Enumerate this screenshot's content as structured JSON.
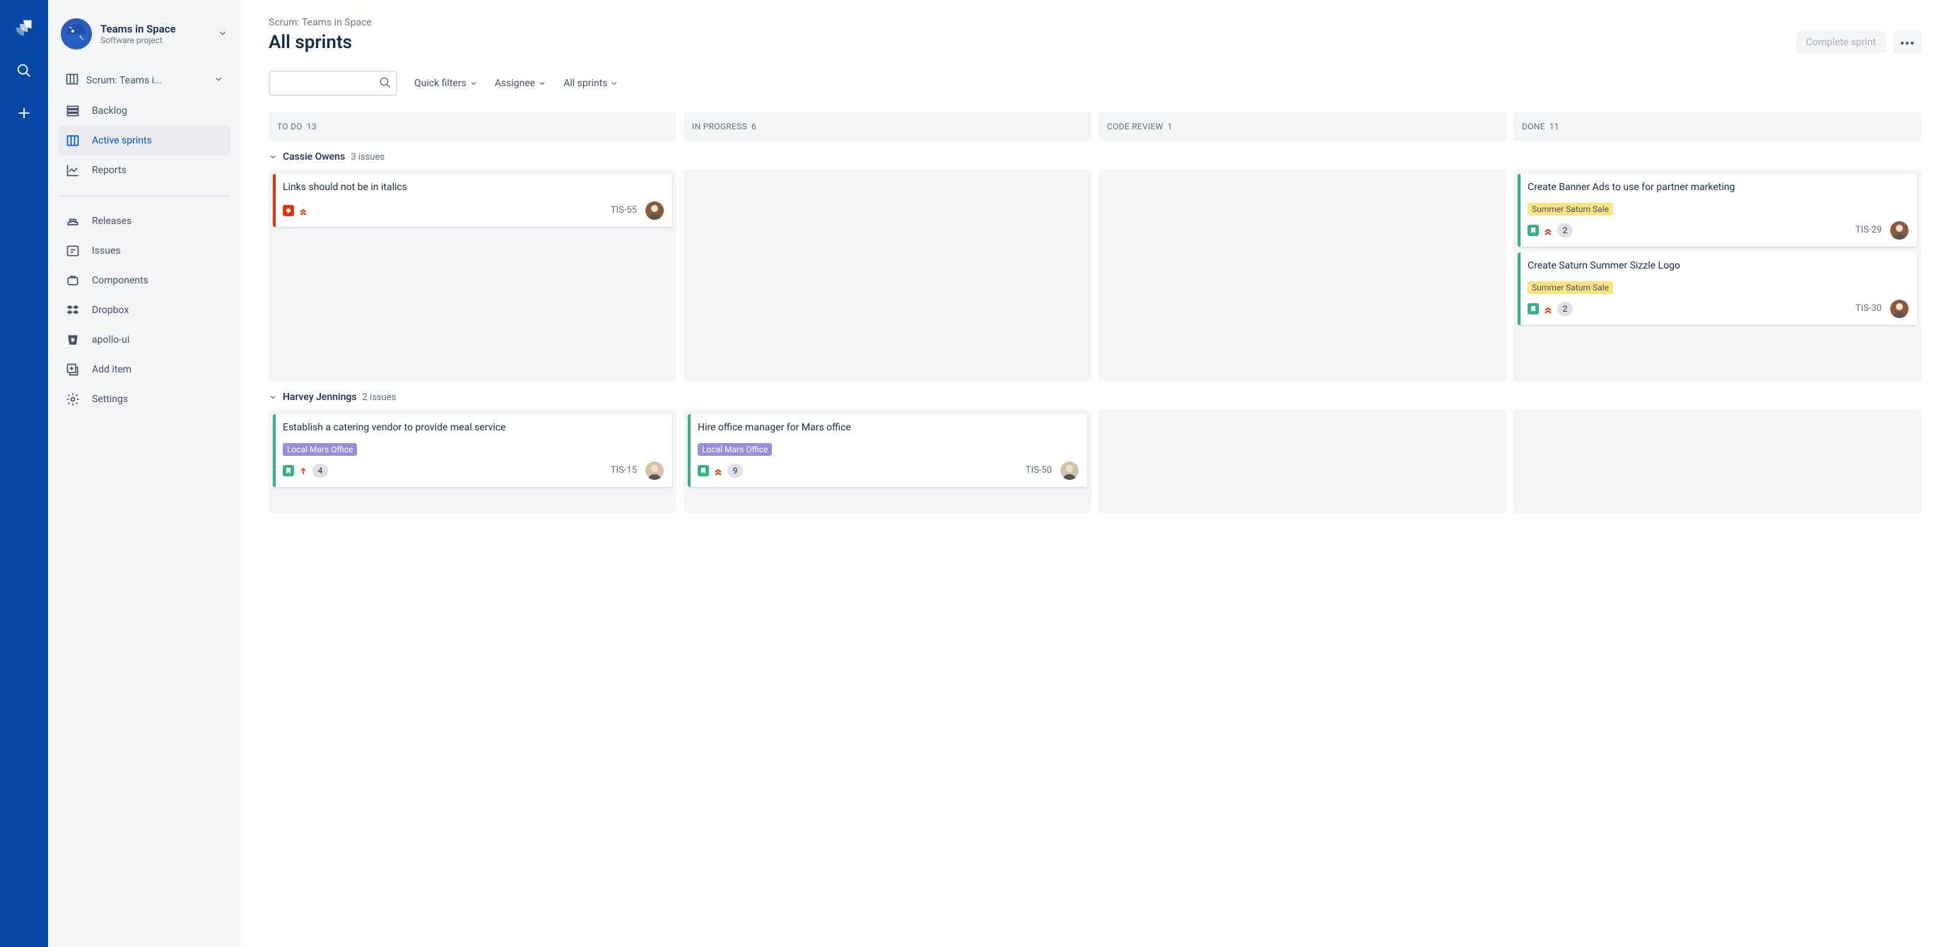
{
  "global_nav": {
    "search_hint": "Search",
    "create_hint": "Create"
  },
  "sidebar": {
    "project_name": "Teams in Space",
    "project_type": "Software project",
    "board_crumb": "Scrum: Teams i...",
    "items": [
      {
        "label": "Backlog"
      },
      {
        "label": "Active sprints"
      },
      {
        "label": "Reports"
      }
    ],
    "bottom": [
      {
        "label": "Releases"
      },
      {
        "label": "Issues"
      },
      {
        "label": "Components"
      },
      {
        "label": "Dropbox"
      },
      {
        "label": "apollo-ui"
      },
      {
        "label": "Add item"
      },
      {
        "label": "Settings"
      }
    ]
  },
  "header": {
    "breadcrumb": "Scrum: Teams in Space",
    "title": "All sprints",
    "complete_btn": "Complete sprint"
  },
  "filters": {
    "quick": "Quick filters",
    "assignee": "Assignee",
    "sprints": "All sprints"
  },
  "columns": [
    {
      "name": "TO DO",
      "count": "13"
    },
    {
      "name": "IN PROGRESS",
      "count": "6"
    },
    {
      "name": "CODE REVIEW",
      "count": "1"
    },
    {
      "name": "DONE",
      "count": "11"
    }
  ],
  "swimlanes": [
    {
      "name": "Cassie Owens",
      "count": "3 issues",
      "cols": [
        [
          {
            "stripe": "red",
            "title": "Links should not be in italics",
            "type": "bug",
            "priority": "highest",
            "key": "TIS-55",
            "avatar": "co"
          }
        ],
        [],
        [],
        [
          {
            "stripe": "grn",
            "title": "Create Banner Ads to use for partner marketing",
            "tag": "Summer Saturn Sale",
            "tagc": "yl",
            "type": "story",
            "priority": "highest",
            "sp": "2",
            "key": "TIS-29",
            "avatar": "co"
          },
          {
            "stripe": "grn",
            "title": "Create Saturn Summer Sizzle Logo",
            "tag": "Summer Saturn Sale",
            "tagc": "yl",
            "type": "story",
            "priority": "highest",
            "sp": "2",
            "key": "TIS-30",
            "avatar": "co"
          }
        ]
      ]
    },
    {
      "name": "Harvey Jennings",
      "count": "2 issues",
      "cols": [
        [
          {
            "stripe": "grn",
            "title": "Establish a catering vendor to provide meal service",
            "tag": "Local Mars Office",
            "tagc": "pr",
            "type": "story",
            "priority": "medium",
            "sp": "4",
            "key": "TIS-15",
            "avatar": "hj"
          }
        ],
        [
          {
            "stripe": "grn",
            "title": "Hire office manager for Mars office",
            "tag": "Local Mars Office",
            "tagc": "pr",
            "type": "story",
            "priority": "highest",
            "sp": "9",
            "key": "TIS-50",
            "avatar": "hj"
          }
        ],
        [],
        []
      ]
    }
  ]
}
